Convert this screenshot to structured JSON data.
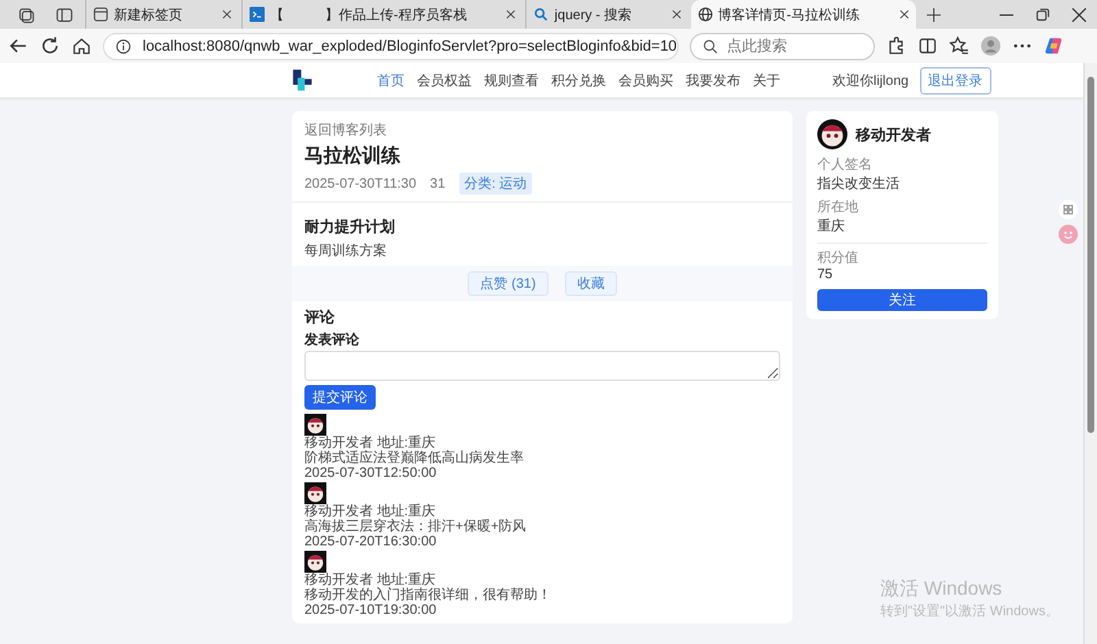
{
  "browser": {
    "tabs": [
      {
        "title": "新建标签页",
        "selected": false,
        "kind": "newtab"
      },
      {
        "title": "【　　　】作品上传-程序员客栈",
        "selected": false,
        "kind": "site"
      },
      {
        "title": "jquery - 搜索",
        "selected": false,
        "kind": "search"
      },
      {
        "title": "博客详情页-马拉松训练",
        "selected": true,
        "kind": "globe"
      }
    ],
    "url": "localhost:8080/qnwb_war_exploded/BloginfoServlet?pro=selectBloginfo&bid=10",
    "search_placeholder": "点此搜索"
  },
  "nav": {
    "items": [
      {
        "label": "首页",
        "selected": true
      },
      {
        "label": "会员权益",
        "selected": false
      },
      {
        "label": "规则查看",
        "selected": false
      },
      {
        "label": "积分兑换",
        "selected": false
      },
      {
        "label": "会员购买",
        "selected": false
      },
      {
        "label": "我要发布",
        "selected": false
      },
      {
        "label": "关于",
        "selected": false
      }
    ],
    "welcome": "欢迎你lijlong",
    "logout": "退出登录"
  },
  "post": {
    "back_link": "返回博客列表",
    "title": "马拉松训练",
    "date": "2025-07-30T11:30",
    "views": "31",
    "category": "分类: 运动",
    "subtitle": "耐力提升计划",
    "body": "每周训练方案",
    "like_button": "点赞 (31)",
    "favorite_button": "收藏"
  },
  "comments": {
    "heading": "评论",
    "form_label": "发表评论",
    "submit": "提交评论",
    "items": [
      {
        "author": "移动开发者 地址:重庆",
        "text": "阶梯式适应法登巅降低高山病发生率",
        "time": "2025-07-30T12:50:00"
      },
      {
        "author": "移动开发者 地址:重庆",
        "text": "高海拔三层穿衣法：排汗+保暖+防风",
        "time": "2025-07-20T16:30:00"
      },
      {
        "author": "移动开发者 地址:重庆",
        "text": "移动开发的入门指南很详细，很有帮助！",
        "time": "2025-07-10T19:30:00"
      }
    ]
  },
  "author_card": {
    "name": "移动开发者",
    "fields": [
      {
        "label": "个人签名",
        "value": "指尖改变生活"
      },
      {
        "label": "所在地",
        "value": "重庆"
      }
    ],
    "score_label": "积分值",
    "score": "75",
    "follow": "关注"
  },
  "os_watermark": {
    "title": "激活 Windows",
    "hint": "转到\"设置\"以激活 Windows。"
  }
}
